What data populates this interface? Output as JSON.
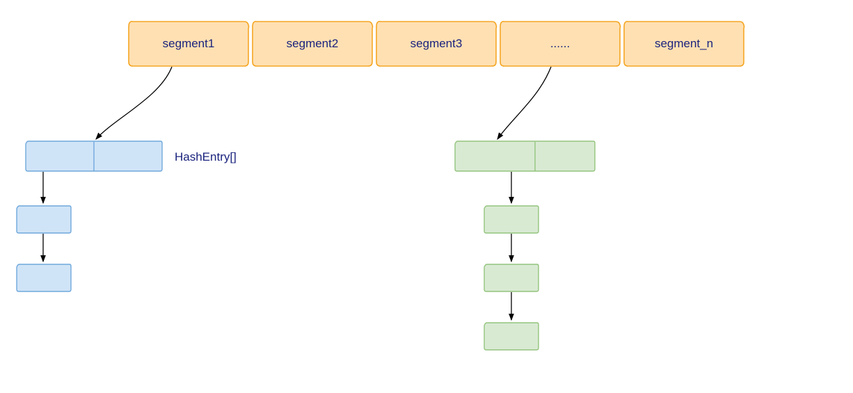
{
  "segments": {
    "items": [
      {
        "label": "segment1"
      },
      {
        "label": "segment2"
      },
      {
        "label": "segment3"
      },
      {
        "label": "......"
      },
      {
        "label": "segment_n"
      }
    ]
  },
  "labels": {
    "hash_entry": "HashEntry[]"
  },
  "colors": {
    "segment_fill": "#ffe0b2",
    "segment_stroke": "#f5a623",
    "blue_fill": "#d0e4f7",
    "blue_stroke": "#6fa8dc",
    "green_fill": "#d9ead3",
    "green_stroke": "#93c47d",
    "text": "#1a237e"
  }
}
